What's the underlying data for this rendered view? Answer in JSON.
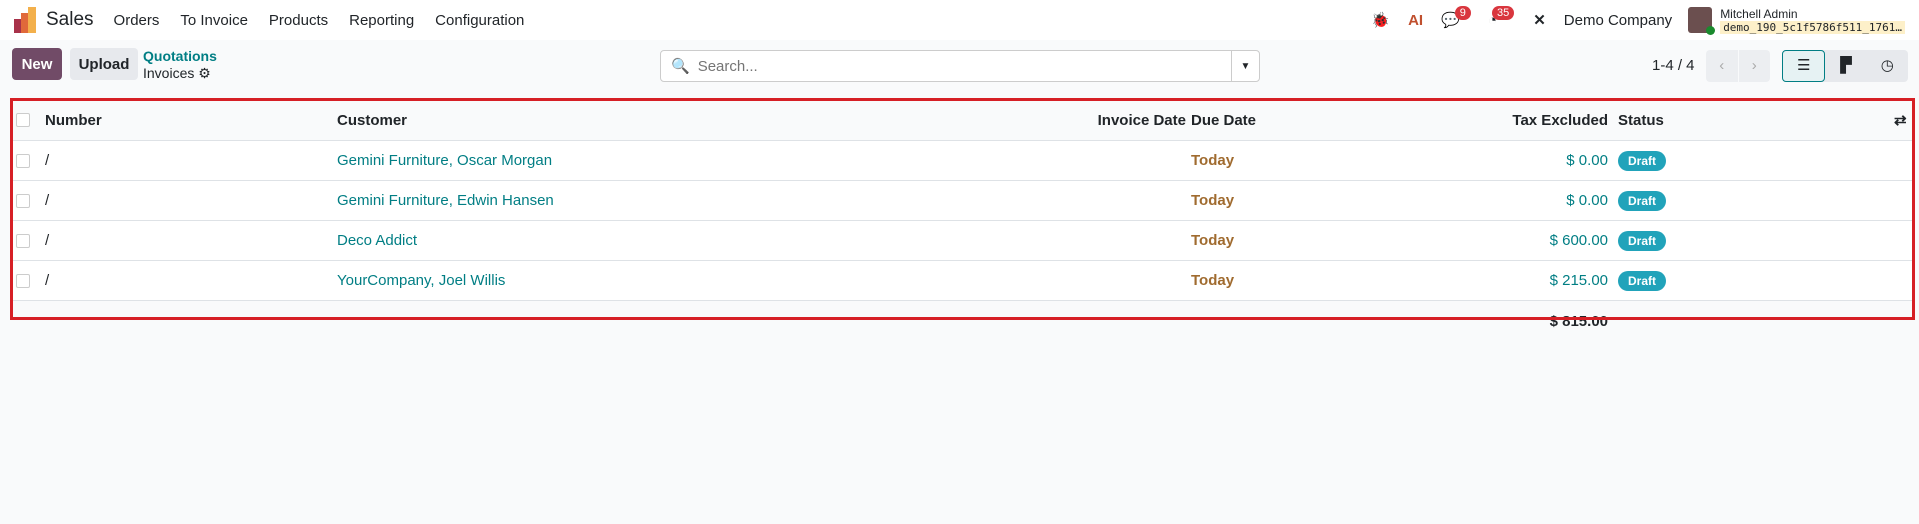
{
  "nav": {
    "app": "Sales",
    "menus": [
      "Orders",
      "To Invoice",
      "Products",
      "Reporting",
      "Configuration"
    ],
    "messages_count": "9",
    "activities_count": "35",
    "company": "Demo Company",
    "user": "Mitchell Admin",
    "database": "demo_190_5c1f5786f511_1761…"
  },
  "control": {
    "new_label": "New",
    "upload_label": "Upload",
    "breadcrumb_parent": "Quotations",
    "breadcrumb_current": "Invoices",
    "search_placeholder": "Search...",
    "pager": "1-4 / 4"
  },
  "table": {
    "headers": {
      "number": "Number",
      "customer": "Customer",
      "invoice_date": "Invoice Date",
      "due_date": "Due Date",
      "tax_excluded": "Tax Excluded",
      "status": "Status"
    },
    "rows": [
      {
        "number": "/",
        "customer": "Gemini Furniture, Oscar Morgan",
        "invoice_date": "",
        "due_date": "Today",
        "tax_excluded": "$ 0.00",
        "status": "Draft"
      },
      {
        "number": "/",
        "customer": "Gemini Furniture, Edwin Hansen",
        "invoice_date": "",
        "due_date": "Today",
        "tax_excluded": "$ 0.00",
        "status": "Draft"
      },
      {
        "number": "/",
        "customer": "Deco Addict",
        "invoice_date": "",
        "due_date": "Today",
        "tax_excluded": "$ 600.00",
        "status": "Draft"
      },
      {
        "number": "/",
        "customer": "YourCompany, Joel Willis",
        "invoice_date": "",
        "due_date": "Today",
        "tax_excluded": "$ 215.00",
        "status": "Draft"
      }
    ],
    "total": "$ 815.00"
  },
  "colors": {
    "primary": "#714b67",
    "link": "#017e84",
    "highlight": "#d61f25"
  }
}
